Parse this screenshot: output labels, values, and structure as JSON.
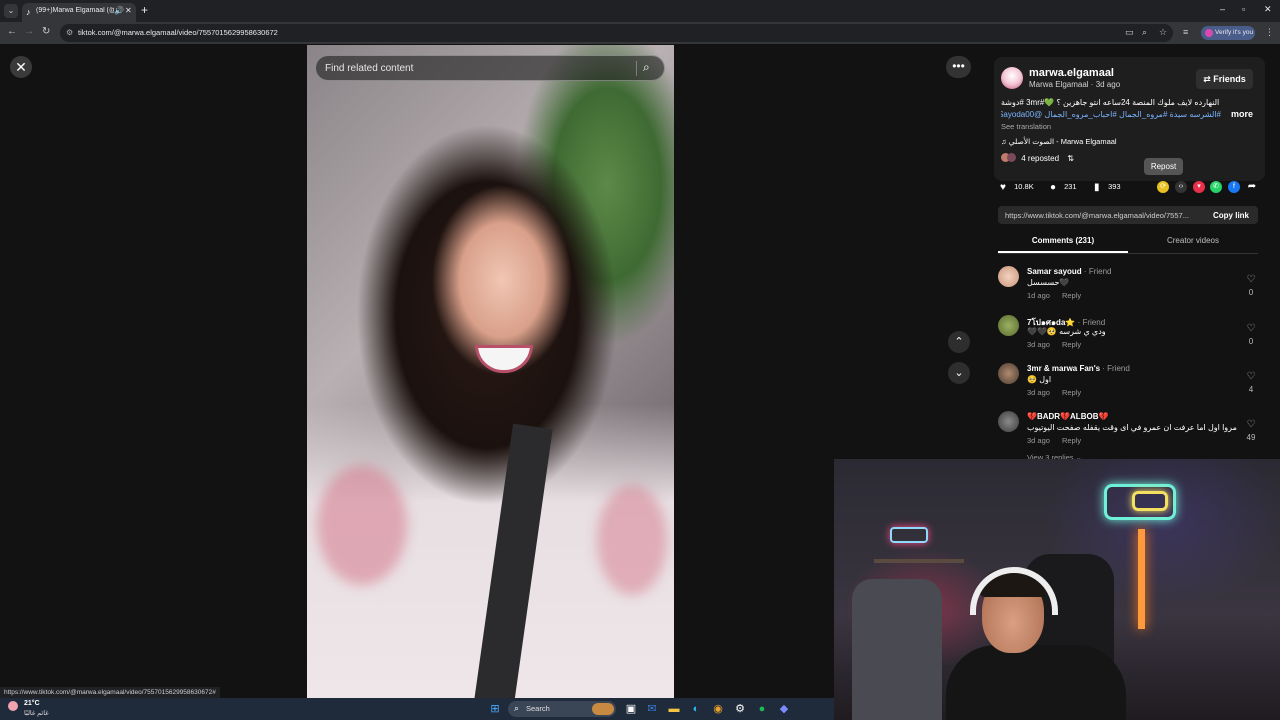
{
  "browser": {
    "tab_title": "(99+)Marwa Elgamaal (@m",
    "url": "tiktok.com/@marwa.elgamaal/video/7557015629958630672",
    "verify_label": "Verify it's you",
    "status_url": "https://www.tiktok.com/@marwa.elgamaal/video/7557015629958630672#"
  },
  "video_page": {
    "search_placeholder": "Find related content"
  },
  "post": {
    "username": "marwa.elgamaal",
    "meta": "Marwa Elgamaal · 3d ago",
    "friends_label": "Friends",
    "desc_line1": "النهارده لايف ملوك المنصة 24ساعه انتو جاهزين ؟ 💚#3mr #دوشة",
    "desc_line2": "#الشرسه سيدة #مروه_الجمال #احباب_مروه_الجمال @3mr @Sayoda00...",
    "more_label": "more",
    "see_translation": "See translation",
    "music": "♫  الصوت الأصلي - Marwa Elgamaal",
    "reposted": "4 reposted",
    "repost_tooltip": "Repost",
    "likes": "10.8K",
    "comments_count": "231",
    "saves": "393",
    "share_link": "https://www.tiktok.com/@marwa.elgamaal/video/7557...",
    "copy_link": "Copy link"
  },
  "tabs": {
    "comments": "Comments (231)",
    "creator_videos": "Creator videos"
  },
  "comments": [
    {
      "name": "Samar sayoud",
      "tag": " · Friend",
      "text": "حسسسل🖤",
      "time": "1d ago",
      "reply": "Reply",
      "likes": "0"
    },
    {
      "name": "7โป๑ศ๑da⭐",
      "tag": " · Friend",
      "text": "🖤🖤🥺 ودي ي شرسه",
      "time": "3d ago",
      "reply": "Reply",
      "likes": "0"
    },
    {
      "name": "3mr & marwa Fan's",
      "tag": " · Friend",
      "text": "🥺 اول",
      "time": "3d ago",
      "reply": "Reply",
      "likes": "4"
    },
    {
      "name": "💔BADR💔ALBOB💔",
      "tag": "",
      "text": "مروا اول اما عرفت ان عمرو في اى وقت يقفله صفحت اليوتيوب",
      "time": "3d ago",
      "reply": "Reply",
      "likes": "49"
    }
  ],
  "view_replies": "View 3 replies ⌄",
  "taskbar": {
    "temp": "21°C",
    "weather_desc": "غائم غالبًا",
    "search_label": "Search"
  }
}
